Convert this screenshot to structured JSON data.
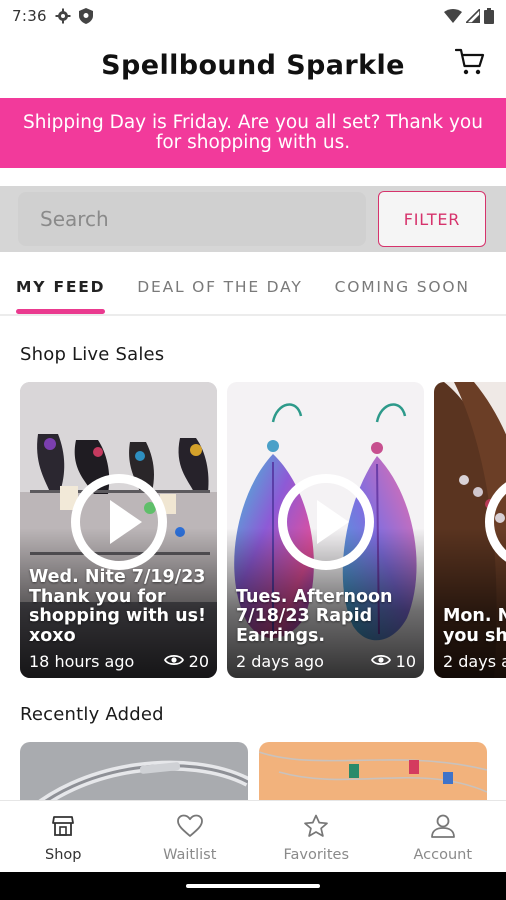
{
  "status_bar": {
    "time": "7:36"
  },
  "header": {
    "title": "Spellbound Sparkle"
  },
  "banner": {
    "text": "Shipping Day is Friday. Are you all set? Thank you for shopping with us."
  },
  "search": {
    "placeholder": "Search",
    "filter_label": "FILTER"
  },
  "tabs": [
    {
      "label": "MY FEED",
      "active": true
    },
    {
      "label": "DEAL OF THE DAY",
      "active": false
    },
    {
      "label": "COMING SOON",
      "active": false
    }
  ],
  "live_sales": {
    "title": "Shop Live Sales",
    "items": [
      {
        "caption": "Wed. Nite 7/19/23 Thank you for shopping with us! xoxo",
        "time_ago": "18 hours ago",
        "views": "20"
      },
      {
        "caption": "Tues. Afternoon 7/18/23 Rapid Earrings.",
        "time_ago": "2 days ago",
        "views": "10"
      },
      {
        "caption": "Mon. Nite Thank you shoppin",
        "time_ago": "2 days a",
        "views": ""
      }
    ]
  },
  "recently_added": {
    "title": "Recently Added"
  },
  "bottom_nav": [
    {
      "label": "Shop",
      "icon": "shop-icon",
      "active": true
    },
    {
      "label": "Waitlist",
      "icon": "heart-icon",
      "active": false
    },
    {
      "label": "Favorites",
      "icon": "star-icon",
      "active": false
    },
    {
      "label": "Account",
      "icon": "person-icon",
      "active": false
    }
  ],
  "colors": {
    "accent": "#f23a9b",
    "filter_border": "#d6336c",
    "tab_indicator": "#ea3a8f"
  }
}
